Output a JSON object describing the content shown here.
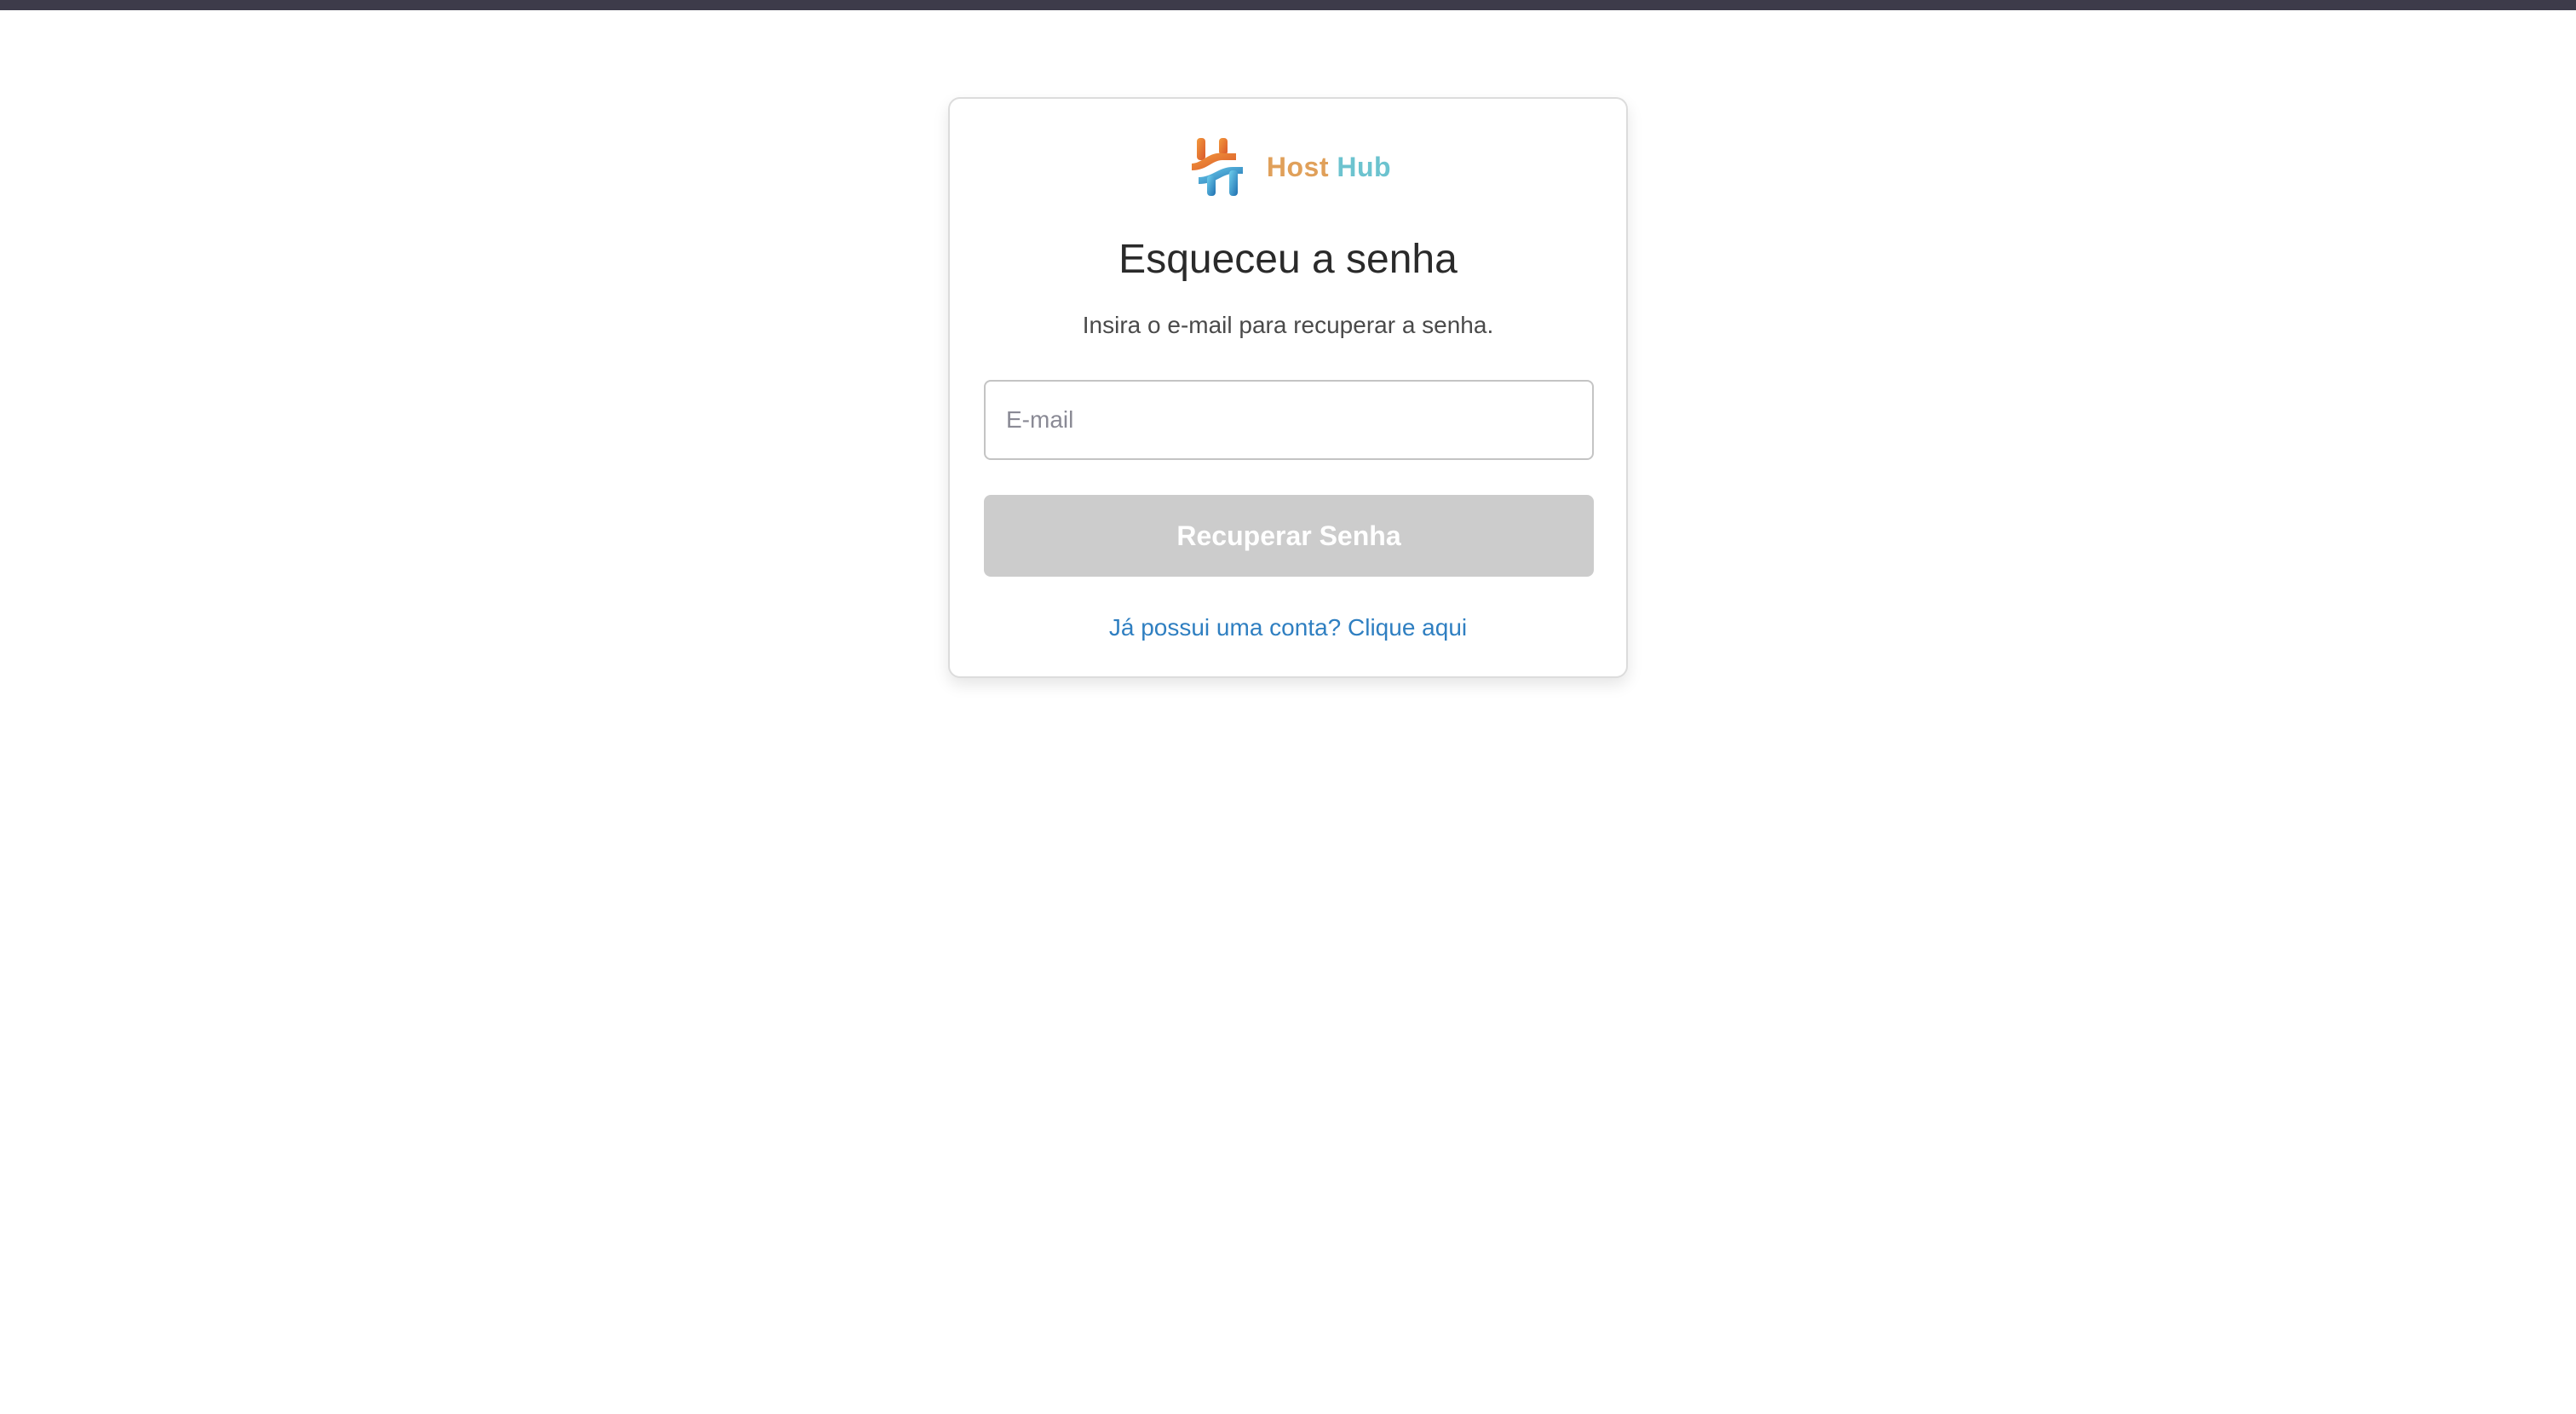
{
  "brand": {
    "name_part1": "Host",
    "name_part2": "Hub",
    "colors": {
      "orange": "#e0a05a",
      "teal": "#6cc3cf",
      "link": "#2f7fc1",
      "button_disabled": "#cccccc",
      "top_bar": "#3d3b4a"
    }
  },
  "form": {
    "title": "Esqueceu a senha",
    "subtitle": "Insira o e-mail para recuperar a senha.",
    "email_placeholder": "E-mail",
    "email_value": "",
    "submit_label": "Recuperar Senha",
    "submit_enabled": false,
    "login_link_label": "Já possui uma conta? Clique aqui"
  }
}
